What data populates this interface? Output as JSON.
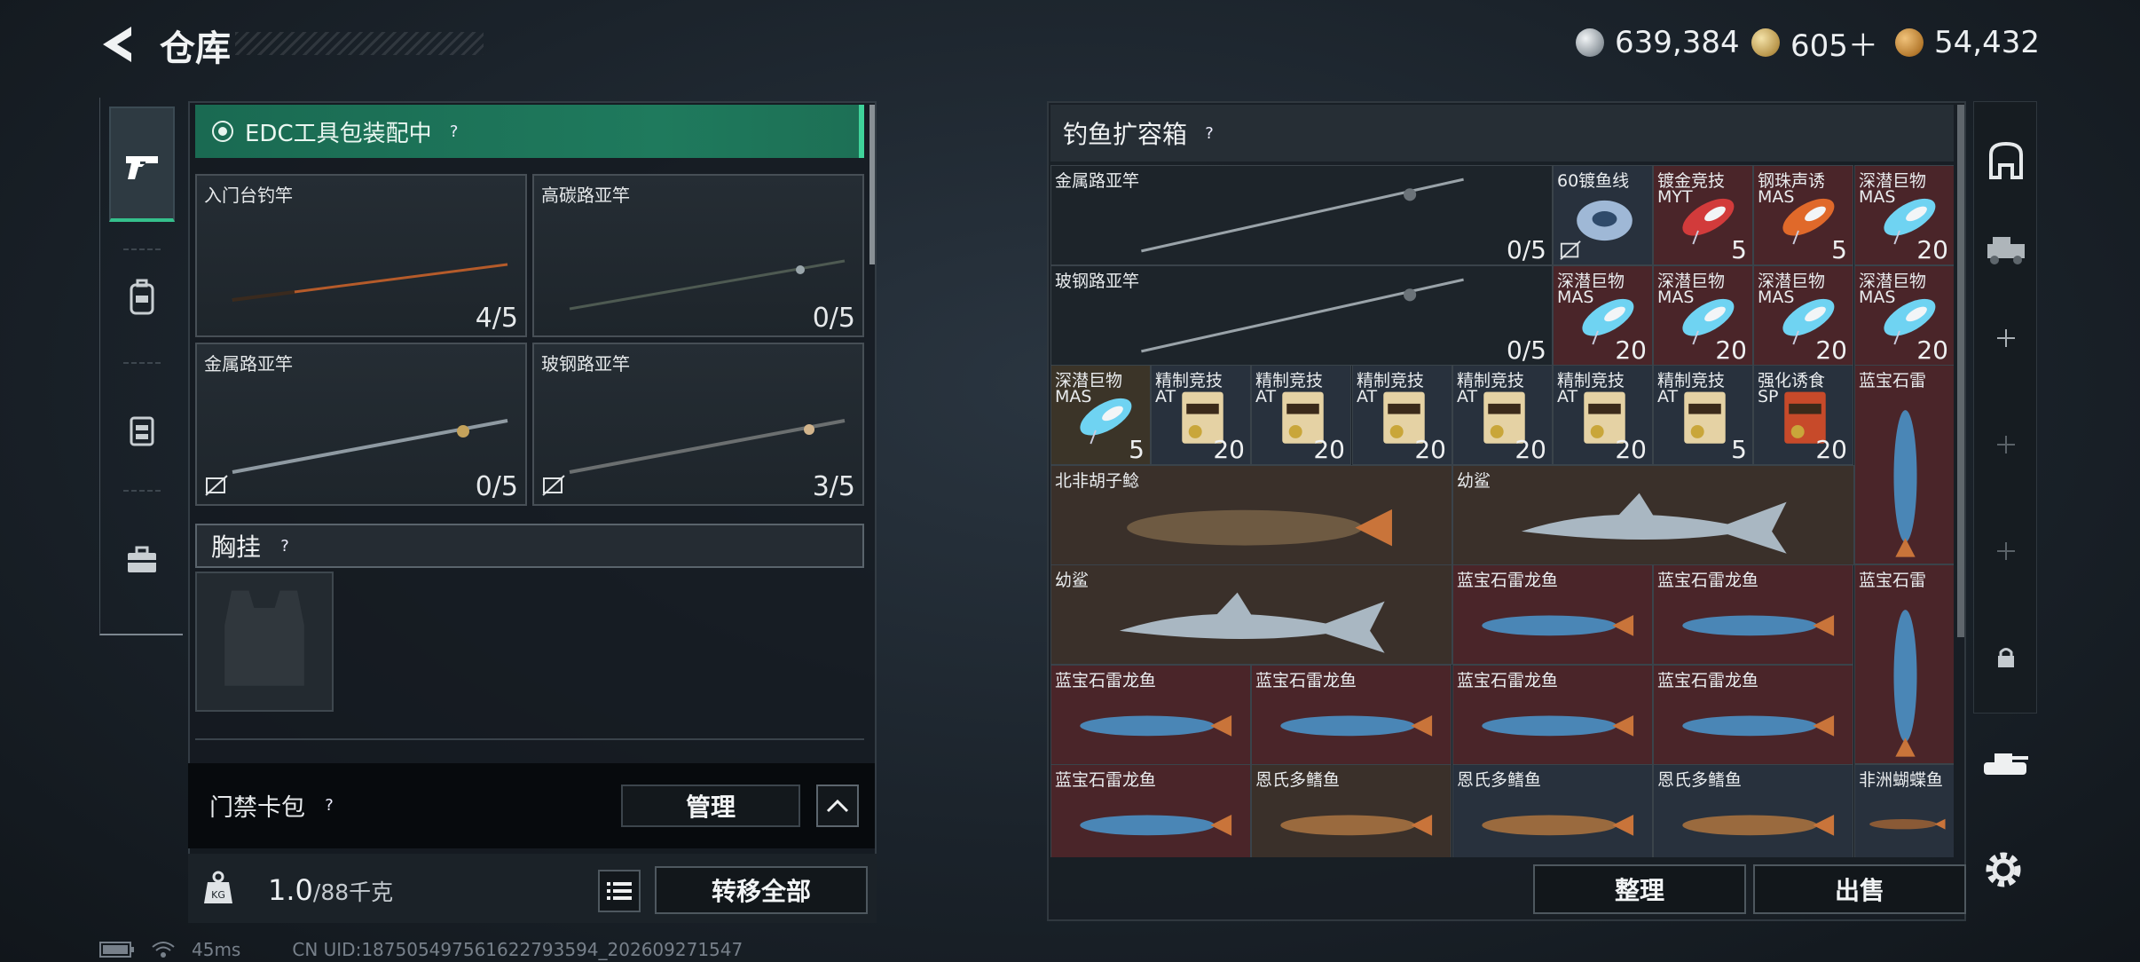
{
  "header": {
    "title": "仓库"
  },
  "currencies": [
    {
      "icon": "silver-coin-icon",
      "value": "639,384",
      "color": "#b8c0c8"
    },
    {
      "icon": "gold-triangle-coin-icon",
      "value": "605＋",
      "color": "#c9a960"
    },
    {
      "icon": "bronze-coin-icon",
      "value": "54,432",
      "color": "#c08a3c"
    }
  ],
  "side_tabs": [
    {
      "name": "pistol",
      "icon": "pistol-icon",
      "active": true
    },
    {
      "name": "backpack",
      "icon": "backpack-icon",
      "active": false
    },
    {
      "name": "vest",
      "icon": "vest-icon",
      "active": false
    },
    {
      "name": "case",
      "icon": "briefcase-icon",
      "active": false
    }
  ],
  "equip_banner": {
    "text": "EDC工具包装配中"
  },
  "rods": [
    {
      "label": "入门台钓竿",
      "count": "4/5",
      "broken": false,
      "color": "#b55b2a"
    },
    {
      "label": "高碳路亚竿",
      "count": "0/5",
      "broken": false,
      "color": "#4e5a52"
    },
    {
      "label": "金属路亚竿",
      "count": "0/5",
      "broken": true,
      "color": "#8f9aa2"
    },
    {
      "label": "玻钢路亚竿",
      "count": "3/5",
      "broken": true,
      "color": "#6b6f70"
    }
  ],
  "chest": {
    "label": "胸挂"
  },
  "card_pack": {
    "label": "门禁卡包",
    "manage_label": "管理"
  },
  "weight": {
    "current": "1.0",
    "max": "/88千克"
  },
  "buttons": {
    "transfer_all": "转移全部",
    "sort": "整理",
    "sell": "出售"
  },
  "box": {
    "title": "钓鱼扩容箱",
    "items": [
      {
        "label": "金属路亚竿",
        "sub": "",
        "qty": "0/5",
        "type": "rod",
        "bg": "dark",
        "broken": true
      },
      {
        "label": "60镀鱼线",
        "sub": "",
        "qty": "",
        "type": "line",
        "bg": "blue",
        "broken": true
      },
      {
        "label": "镀金竞技",
        "sub": "MYT",
        "qty": "5",
        "type": "lure-red",
        "bg": "red"
      },
      {
        "label": "钢珠声诱",
        "sub": "MAS",
        "qty": "5",
        "type": "lure-orange",
        "bg": "red"
      },
      {
        "label": "深潜巨物",
        "sub": "MAS",
        "qty": "20",
        "type": "lure-blue",
        "bg": "red"
      },
      {
        "label": "玻钢路亚竿",
        "sub": "",
        "qty": "0/5",
        "type": "rod",
        "bg": "dark"
      },
      {
        "label": "深潜巨物",
        "sub": "MAS",
        "qty": "20",
        "type": "lure-blue",
        "bg": "red"
      },
      {
        "label": "深潜巨物",
        "sub": "MAS",
        "qty": "20",
        "type": "lure-blue",
        "bg": "red"
      },
      {
        "label": "深潜巨物",
        "sub": "MAS",
        "qty": "20",
        "type": "lure-blue",
        "bg": "red"
      },
      {
        "label": "深潜巨物",
        "sub": "MAS",
        "qty": "20",
        "type": "lure-blue",
        "bg": "red"
      },
      {
        "label": "深潜巨物",
        "sub": "MAS",
        "qty": "5",
        "type": "lure-blue",
        "bg": "gold"
      },
      {
        "label": "精制竞技",
        "sub": "AT",
        "qty": "20",
        "type": "bait",
        "bg": "blue"
      },
      {
        "label": "精制竞技",
        "sub": "AT",
        "qty": "20",
        "type": "bait",
        "bg": "blue"
      },
      {
        "label": "精制竞技",
        "sub": "AT",
        "qty": "20",
        "type": "bait",
        "bg": "blue"
      },
      {
        "label": "精制竞技",
        "sub": "AT",
        "qty": "20",
        "type": "bait",
        "bg": "blue"
      },
      {
        "label": "精制竞技",
        "sub": "AT",
        "qty": "20",
        "type": "bait",
        "bg": "blue"
      },
      {
        "label": "精制竞技",
        "sub": "AT",
        "qty": "5",
        "type": "bait",
        "bg": "blue"
      },
      {
        "label": "强化诱食",
        "sub": "SP",
        "qty": "20",
        "type": "bait-red",
        "bg": "blue"
      },
      {
        "label": "蓝宝石雷",
        "sub": "",
        "qty": "",
        "type": "snakehead-v",
        "bg": "red"
      },
      {
        "label": "北非胡子鲶",
        "sub": "",
        "qty": "",
        "type": "catfish",
        "bg": "brown"
      },
      {
        "label": "幼鲨",
        "sub": "",
        "qty": "",
        "type": "shark",
        "bg": "brown"
      },
      {
        "label": "幼鲨",
        "sub": "",
        "qty": "",
        "type": "shark",
        "bg": "brown"
      },
      {
        "label": "蓝宝石雷龙鱼",
        "sub": "",
        "qty": "",
        "type": "snakehead",
        "bg": "red"
      },
      {
        "label": "蓝宝石雷龙鱼",
        "sub": "",
        "qty": "",
        "type": "snakehead",
        "bg": "red"
      },
      {
        "label": "蓝宝石雷",
        "sub": "",
        "qty": "",
        "type": "snakehead-v",
        "bg": "red"
      },
      {
        "label": "蓝宝石雷龙鱼",
        "sub": "",
        "qty": "",
        "type": "snakehead",
        "bg": "red"
      },
      {
        "label": "蓝宝石雷龙鱼",
        "sub": "",
        "qty": "",
        "type": "snakehead",
        "bg": "red"
      },
      {
        "label": "蓝宝石雷龙鱼",
        "sub": "",
        "qty": "",
        "type": "snakehead",
        "bg": "red"
      },
      {
        "label": "蓝宝石雷龙鱼",
        "sub": "",
        "qty": "",
        "type": "snakehead",
        "bg": "red"
      },
      {
        "label": "蓝宝石雷龙鱼",
        "sub": "",
        "qty": "",
        "type": "snakehead",
        "bg": "red"
      },
      {
        "label": "恩氏多鳍鱼",
        "sub": "",
        "qty": "",
        "type": "bichir",
        "bg": "brown"
      },
      {
        "label": "恩氏多鳍鱼",
        "sub": "",
        "qty": "",
        "type": "bichir",
        "bg": "blue"
      },
      {
        "label": "恩氏多鳍鱼",
        "sub": "",
        "qty": "",
        "type": "bichir",
        "bg": "blue"
      },
      {
        "label": "非洲蝴蝶鱼",
        "sub": "",
        "qty": "",
        "type": "butterfly",
        "bg": "blue"
      }
    ]
  },
  "right_nav": [
    {
      "icon": "safe-icon"
    },
    {
      "icon": "vehicle-icon"
    },
    {
      "icon": "plus-icon"
    },
    {
      "icon": "plus-icon"
    },
    {
      "icon": "plus-icon"
    },
    {
      "icon": "lock-icon"
    },
    {
      "icon": "tank-icon"
    }
  ],
  "status": {
    "ping": "45ms",
    "uid": "CN UID:18750549756162279359​4_202609271547"
  }
}
